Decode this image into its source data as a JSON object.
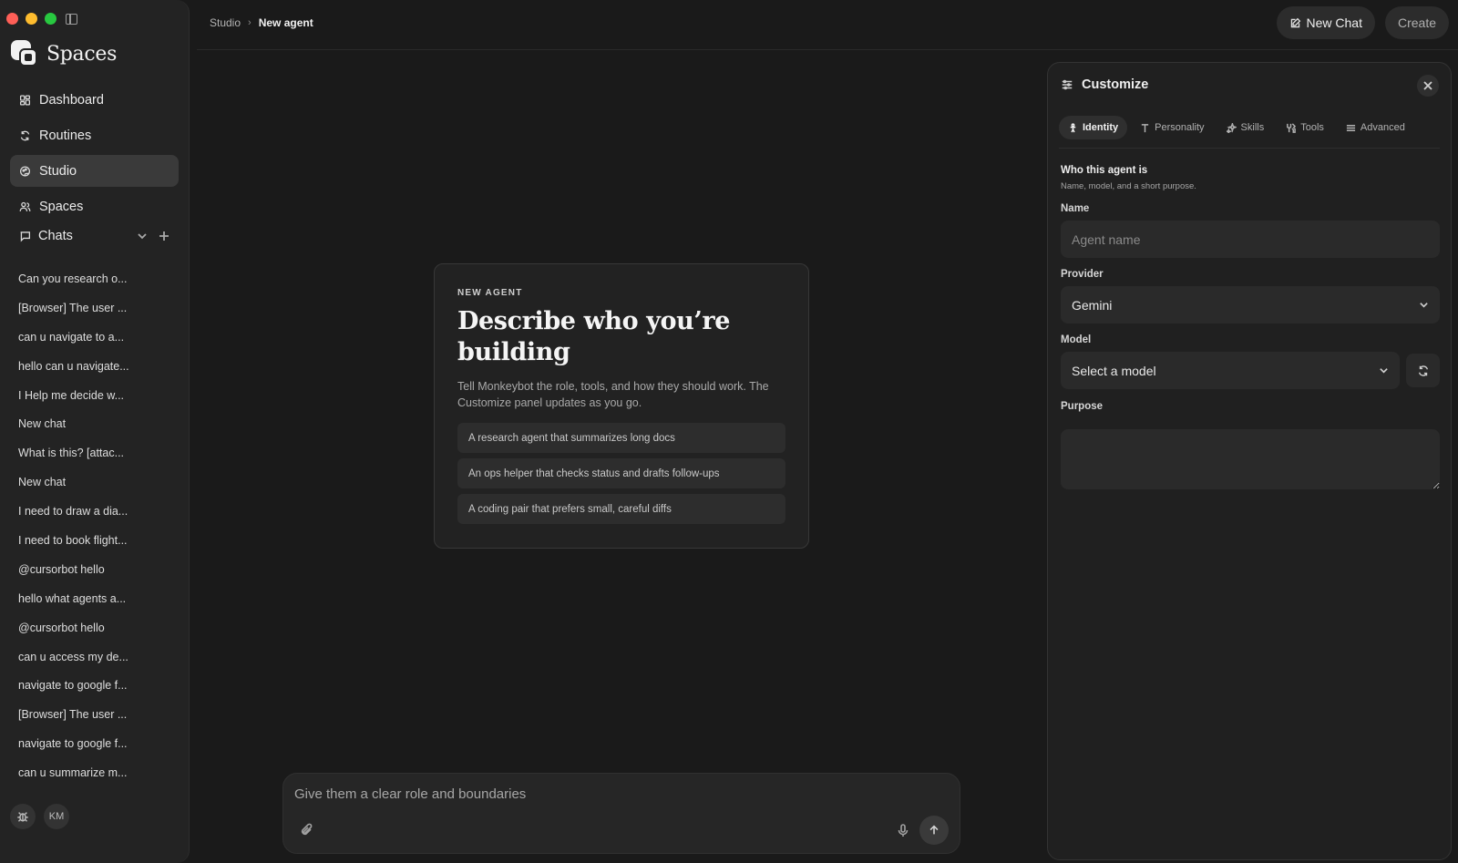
{
  "sidebar": {
    "brand": "Spaces",
    "nav": [
      {
        "label": "Dashboard",
        "icon": "dashboard-icon"
      },
      {
        "label": "Routines",
        "icon": "refresh-icon"
      },
      {
        "label": "Studio",
        "icon": "studio-icon"
      },
      {
        "label": "Spaces",
        "icon": "people-icon"
      }
    ],
    "chats_label": "Chats",
    "chats": [
      "Can you research o...",
      "[Browser] The user ...",
      "can u navigate to a...",
      "hello can u navigate...",
      "I Help me decide w...",
      "New chat",
      "What is this? [attac...",
      "New chat",
      "I need to draw a dia...",
      "I need to book flight...",
      "@cursorbot hello",
      "hello what agents a...",
      "@cursorbot hello",
      "can u access my de...",
      "navigate to google f...",
      "[Browser] The user ...",
      "navigate to google f...",
      "can u summarize m..."
    ],
    "user_initials": "KM"
  },
  "topbar": {
    "breadcrumb_root": "Studio",
    "breadcrumb_current": "New agent",
    "new_chat_label": "New Chat",
    "create_label": "Create"
  },
  "card": {
    "eyebrow": "NEW AGENT",
    "title_line1": "Describe who you’re",
    "title_line2": "building",
    "description": "Tell Monkeybot the role, tools, and how they should work. The Customize panel updates as you go.",
    "suggestions": [
      "A research agent that summarizes long docs",
      "An ops helper that checks status and drafts follow-ups",
      "A coding pair that prefers small, careful diffs"
    ]
  },
  "composer": {
    "placeholder": "Give them a clear role and boundaries"
  },
  "panel": {
    "title": "Customize",
    "tabs": [
      "Identity",
      "Personality",
      "Skills",
      "Tools",
      "Advanced"
    ],
    "active_tab": "Identity",
    "section_title": "Who this agent is",
    "section_subtitle": "Name, model, and a short purpose.",
    "name_label": "Name",
    "name_placeholder": "Agent name",
    "provider_label": "Provider",
    "provider_value": "Gemini",
    "model_label": "Model",
    "model_value": "Select a model",
    "purpose_label": "Purpose"
  },
  "colors": {
    "background": "#1a1a1a",
    "sidebar": "#232323",
    "panel": "#202020",
    "traffic_red": "#fe5f57",
    "traffic_yellow": "#febc2e",
    "traffic_green": "#28c840"
  }
}
